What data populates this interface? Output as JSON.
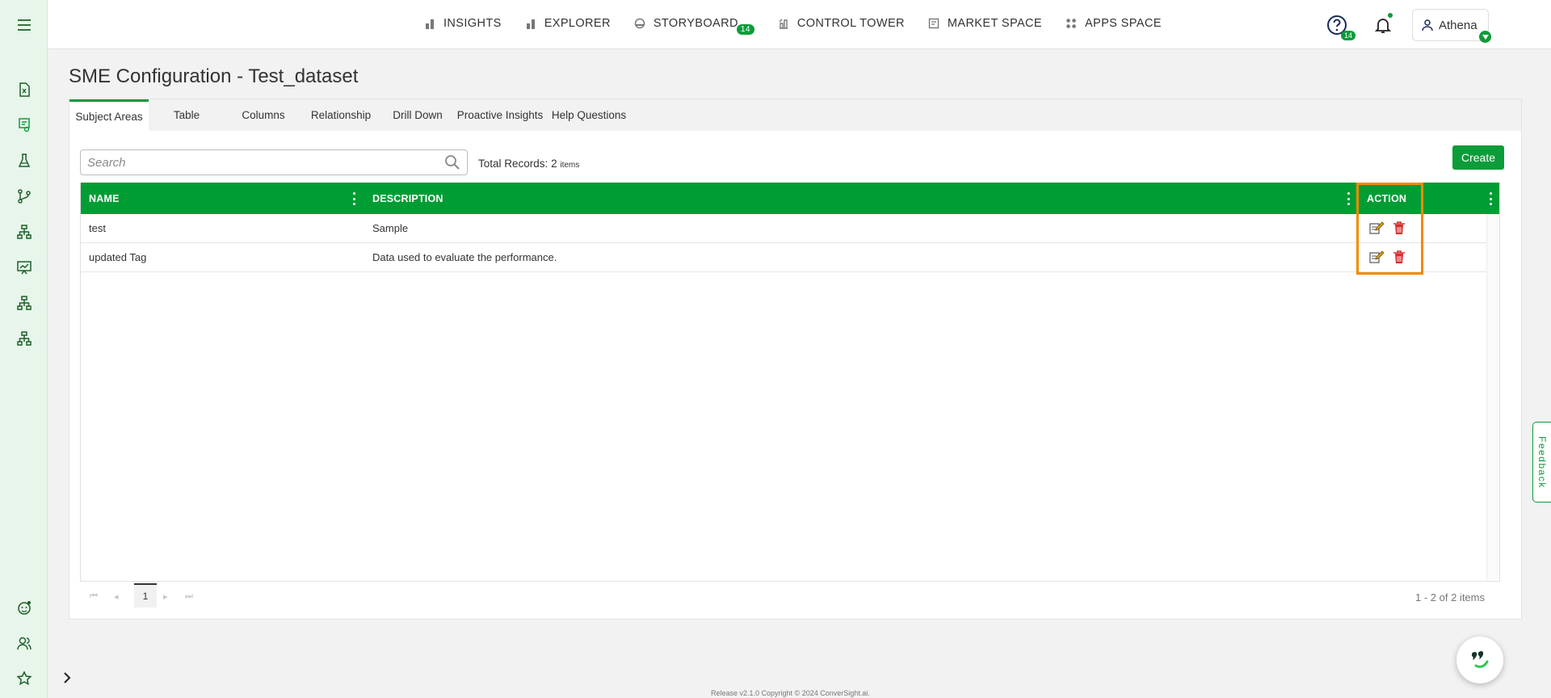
{
  "nav": {
    "items": [
      {
        "label": "INSIGHTS",
        "icon": "bar-chart-icon"
      },
      {
        "label": "EXPLORER",
        "icon": "bar-chart-icon"
      },
      {
        "label": "STORYBOARD",
        "icon": "storyboard-icon",
        "badge": "14"
      },
      {
        "label": "CONTROL TOWER",
        "icon": "tower-icon"
      },
      {
        "label": "MARKET SPACE",
        "icon": "market-icon"
      },
      {
        "label": "APPS SPACE",
        "icon": "apps-icon"
      }
    ]
  },
  "header": {
    "notification_count": "14",
    "user_name": "Athena"
  },
  "page": {
    "title": "SME Configuration - Test_dataset"
  },
  "tabs": [
    {
      "label": "Subject Areas",
      "active": true
    },
    {
      "label": "Table"
    },
    {
      "label": "Columns"
    },
    {
      "label": "Relationship"
    },
    {
      "label": "Drill Down"
    },
    {
      "label": "Proactive Insights"
    },
    {
      "label": "Help Questions"
    }
  ],
  "toolbar": {
    "search_placeholder": "Search",
    "total_label": "Total Records:",
    "total_count": "2",
    "total_unit": "items",
    "create_label": "Create"
  },
  "grid": {
    "columns": {
      "name": "NAME",
      "description": "DESCRIPTION",
      "action": "ACTION"
    },
    "rows": [
      {
        "name": "test",
        "description": "Sample"
      },
      {
        "name": "updated Tag",
        "description": "Data used to evaluate the performance."
      }
    ]
  },
  "pager": {
    "page": "1",
    "info": "1 - 2 of 2 items"
  },
  "feedback_label": "Feedback",
  "footer_text": "Release v2.1.0 Copyright © 2024 ConverSight.ai.",
  "colors": {
    "brand_green": "#009d35",
    "highlight_orange": "#f28b00",
    "delete_red": "#d32f2f"
  }
}
